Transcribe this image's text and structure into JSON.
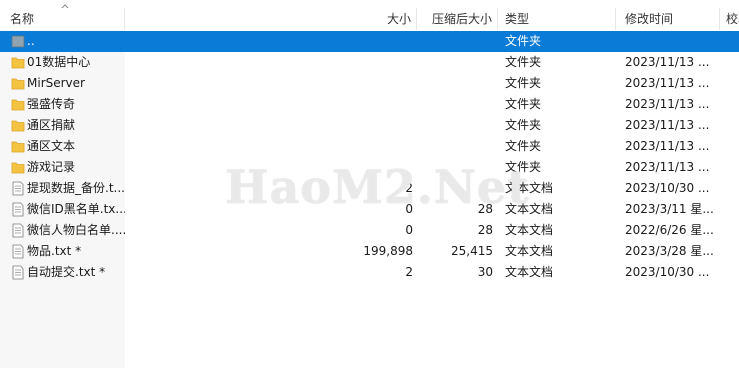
{
  "columns": {
    "name": "名称",
    "size": "大小",
    "packed": "压缩后大小",
    "type": "类型",
    "modified": "修改时间",
    "checksum": "校验"
  },
  "sort": {
    "column": "name",
    "direction": "ascending"
  },
  "rows": [
    {
      "icon": "parent-folder-icon",
      "name": "..",
      "size": "",
      "packed": "",
      "type": "文件夹",
      "modified": "",
      "selected": true
    },
    {
      "icon": "folder-icon",
      "name": "01数据中心",
      "size": "",
      "packed": "",
      "type": "文件夹",
      "modified": "2023/11/13 ..."
    },
    {
      "icon": "folder-icon",
      "name": "MirServer",
      "size": "",
      "packed": "",
      "type": "文件夹",
      "modified": "2023/11/13 ..."
    },
    {
      "icon": "folder-icon",
      "name": "强盛传奇",
      "size": "",
      "packed": "",
      "type": "文件夹",
      "modified": "2023/11/13 ..."
    },
    {
      "icon": "folder-icon",
      "name": "通区捐献",
      "size": "",
      "packed": "",
      "type": "文件夹",
      "modified": "2023/11/13 ..."
    },
    {
      "icon": "folder-icon",
      "name": "通区文本",
      "size": "",
      "packed": "",
      "type": "文件夹",
      "modified": "2023/11/13 ..."
    },
    {
      "icon": "folder-icon",
      "name": "游戏记录",
      "size": "",
      "packed": "",
      "type": "文件夹",
      "modified": "2023/11/13 ..."
    },
    {
      "icon": "text-file-icon",
      "name": "提现数据_备份.t...",
      "size": "2",
      "packed": "",
      "type": "文本文档",
      "modified": "2023/10/30 ..."
    },
    {
      "icon": "text-file-icon",
      "name": "微信ID黑名单.tx...",
      "size": "0",
      "packed": "28",
      "type": "文本文档",
      "modified": "2023/3/11 星..."
    },
    {
      "icon": "text-file-icon",
      "name": "微信人物白名单....",
      "size": "0",
      "packed": "28",
      "type": "文本文档",
      "modified": "2022/6/26 星..."
    },
    {
      "icon": "text-file-icon",
      "name": "物品.txt *",
      "size": "199,898",
      "packed": "25,415",
      "type": "文本文档",
      "modified": "2023/3/28 星..."
    },
    {
      "icon": "text-file-icon",
      "name": "自动提交.txt *",
      "size": "2",
      "packed": "30",
      "type": "文本文档",
      "modified": "2023/10/30 ..."
    }
  ],
  "watermark": "HaoM2.Net",
  "colors": {
    "selection": "#0a7bd6",
    "folder": "#f5c342",
    "folder_dark": "#dba628"
  }
}
